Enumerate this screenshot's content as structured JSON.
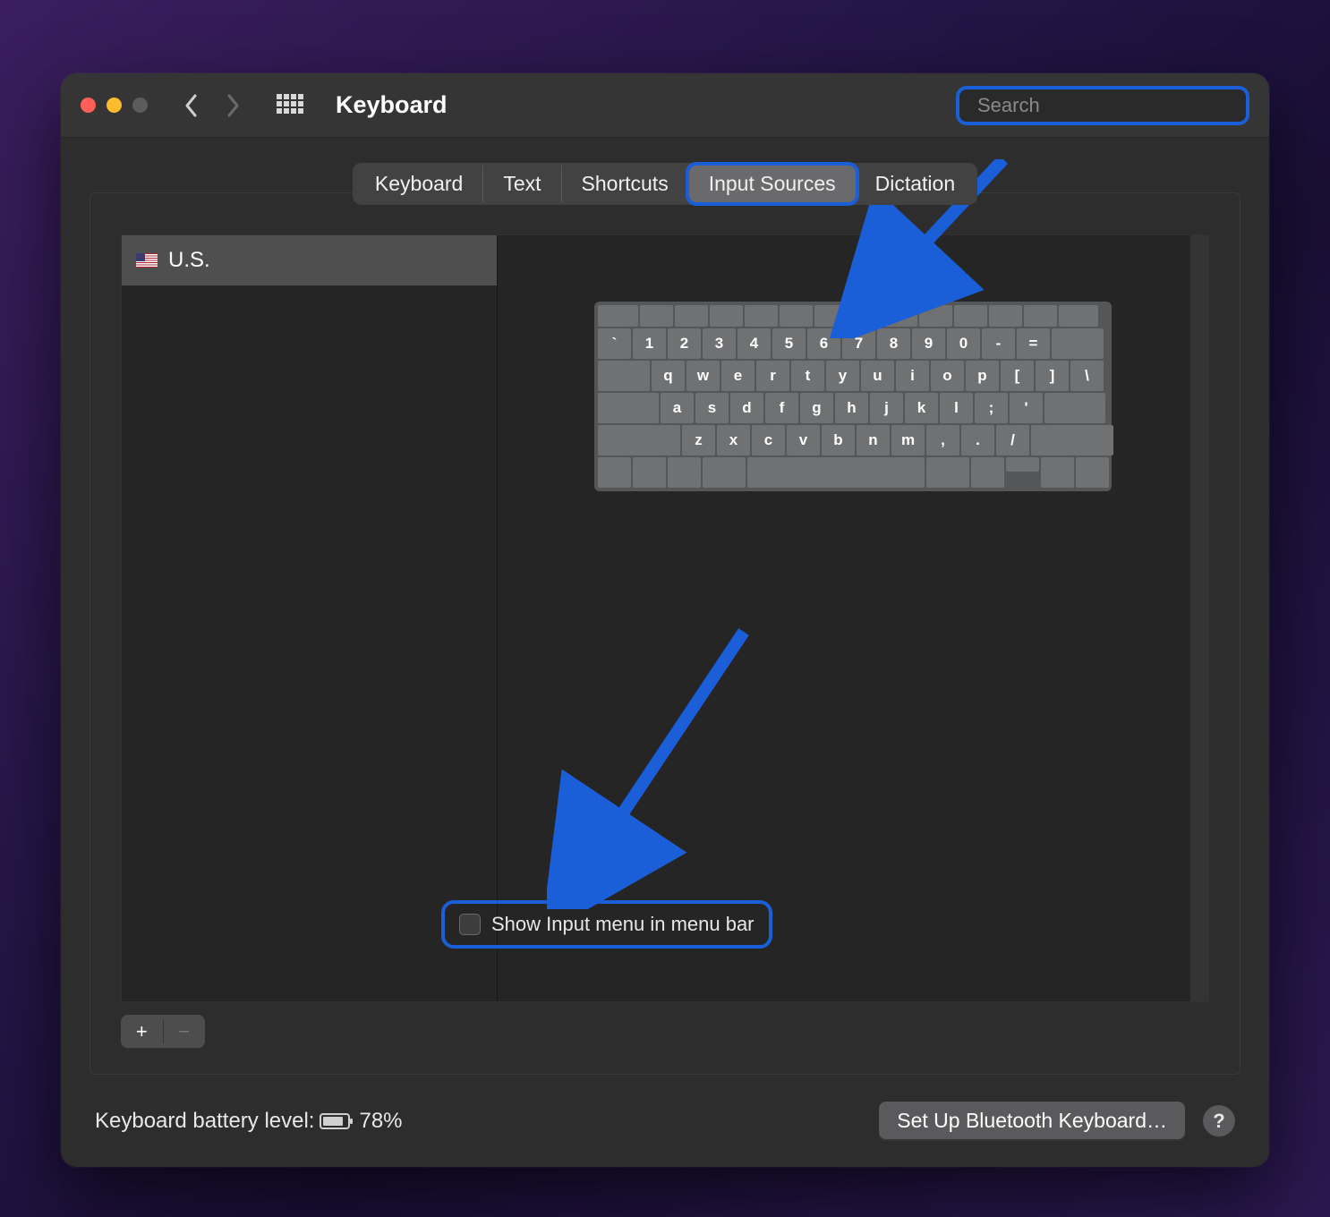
{
  "window": {
    "title": "Keyboard"
  },
  "search": {
    "placeholder": "Search"
  },
  "tabs": [
    {
      "label": "Keyboard"
    },
    {
      "label": "Text"
    },
    {
      "label": "Shortcuts"
    },
    {
      "label": "Input Sources"
    },
    {
      "label": "Dictation"
    }
  ],
  "active_tab_index": 3,
  "sources": [
    {
      "label": "U.S.",
      "flag": "us"
    }
  ],
  "keyboard_preview_layout": "QWERTY",
  "keyboard_rows": {
    "r1": [
      "`",
      "1",
      "2",
      "3",
      "4",
      "5",
      "6",
      "7",
      "8",
      "9",
      "0",
      "-",
      "="
    ],
    "r2": [
      "q",
      "w",
      "e",
      "r",
      "t",
      "y",
      "u",
      "i",
      "o",
      "p",
      "[",
      "]",
      "\\"
    ],
    "r3": [
      "a",
      "s",
      "d",
      "f",
      "g",
      "h",
      "j",
      "k",
      "l",
      ";",
      "'"
    ],
    "r4": [
      "z",
      "x",
      "c",
      "v",
      "b",
      "n",
      "m",
      ",",
      ".",
      "/"
    ]
  },
  "show_input_menu": {
    "label": "Show Input menu in menu bar",
    "checked": false
  },
  "footer": {
    "battery_label": "Keyboard battery level:",
    "battery_pct": "78%",
    "bluetooth_button": "Set Up Bluetooth Keyboard…",
    "help": "?"
  },
  "icons": {
    "plus": "+",
    "minus": "−"
  },
  "annotations": {
    "highlight_color": "#1a5ed8",
    "arrows": [
      "to Input Sources tab",
      "to Show Input menu checkbox"
    ]
  }
}
